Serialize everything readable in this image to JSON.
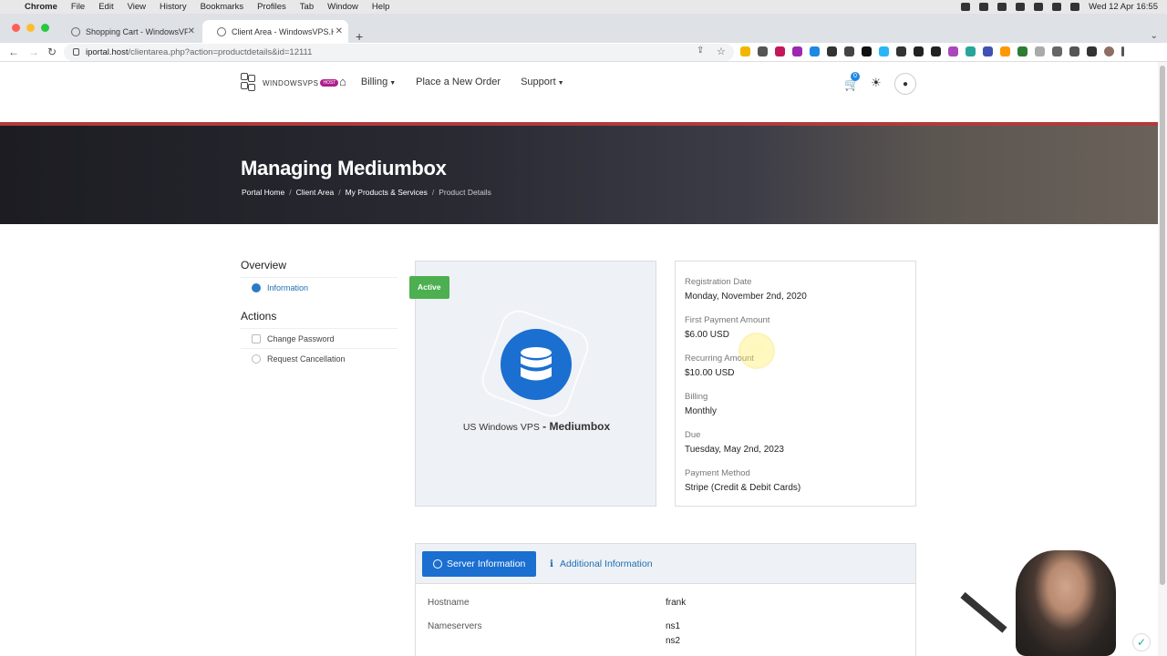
{
  "os_menubar": {
    "app": "Chrome",
    "menus": [
      "File",
      "Edit",
      "View",
      "History",
      "Bookmarks",
      "Profiles",
      "Tab",
      "Window",
      "Help"
    ],
    "clock": "Wed 12 Apr  16:55"
  },
  "browser": {
    "tabs": [
      {
        "title": "Shopping Cart - WindowsVPS",
        "active": false
      },
      {
        "title": "Client Area - WindowsVPS.Hos",
        "active": true
      }
    ],
    "url_host": "iportal.host",
    "url_path": "/clientarea.php?action=productdetails&id=12111"
  },
  "site_nav": {
    "logo_text": "WINDOWSVPS",
    "logo_pill": "HOST",
    "billing": "Billing",
    "place_order": "Place a New Order",
    "support": "Support",
    "cart_count": "0"
  },
  "hero": {
    "title": "Managing Mediumbox",
    "breadcrumbs": [
      "Portal Home",
      "Client Area",
      "My Products & Services",
      "Product Details"
    ]
  },
  "sidebar": {
    "overview_heading": "Overview",
    "overview_items": [
      {
        "label": "Information"
      }
    ],
    "actions_heading": "Actions",
    "action_items": [
      {
        "label": "Change Password"
      },
      {
        "label": "Request Cancellation"
      }
    ]
  },
  "product": {
    "status": "Active",
    "group": "US Windows VPS",
    "separator": " - ",
    "name": "Mediumbox"
  },
  "details": [
    {
      "label": "Registration Date",
      "value": "Monday, November 2nd, 2020"
    },
    {
      "label": "First Payment Amount",
      "value": "$6.00 USD"
    },
    {
      "label": "Recurring Amount",
      "value": "$10.00 USD"
    },
    {
      "label": "Billing",
      "value": "Monthly"
    },
    {
      "label": "Due",
      "value": "Tuesday, May 2nd, 2023"
    },
    {
      "label": "Payment Method",
      "value": "Stripe (Credit & Debit Cards)"
    }
  ],
  "server_tabs": {
    "server_info": "Server Information",
    "additional_info": "Additional Information"
  },
  "server_info": {
    "hostname_label": "Hostname",
    "hostname": "frank",
    "nameservers_label": "Nameservers",
    "ns1": "ns1",
    "ns2": "ns2"
  },
  "colors": {
    "accent": "#1a6fd0",
    "status_active": "#4caf50",
    "hero_border": "#b23a3a"
  }
}
